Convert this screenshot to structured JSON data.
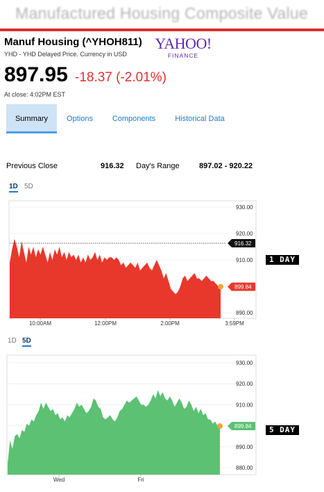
{
  "banner": {
    "title": "Manufactured Housing Composite Value"
  },
  "quote": {
    "name": "Manuf Housing (^YHOH811)",
    "subtitle": "YHD - YHD Delayed Price. Currency in USD",
    "price": "897.95",
    "change": "-18.37 (-2.01%)",
    "close_time": "At close: 4:02PM EST"
  },
  "logo": {
    "main": "YAHOO!",
    "sub": "FINANCE"
  },
  "tabs": [
    {
      "label": "Summary"
    },
    {
      "label": "Options"
    },
    {
      "label": "Components"
    },
    {
      "label": "Historical Data"
    }
  ],
  "stats": {
    "prev_close_label": "Previous Close",
    "prev_close_value": "916.32",
    "days_range_label": "Day's Range",
    "days_range_value": "897.02 - 920.22"
  },
  "range_tabs": {
    "one_day": "1D",
    "five_day": "5D"
  },
  "labels": {
    "one_day": "1 DAY",
    "five_day": "5 DAY"
  },
  "colors": {
    "down": "#e8382c",
    "up": "#5cc173",
    "accent": "#1f79d0",
    "marker": "#f2a33a"
  },
  "chart_data": [
    {
      "type": "area",
      "range": "1D",
      "color": "#e8382c",
      "ylim": [
        890,
        930
      ],
      "yticks": [
        "930.00",
        "920.00",
        "910.00",
        "900.00",
        "890.00"
      ],
      "xticks": [
        "10:00AM",
        "12:00PM",
        "2:00PM",
        "3:59PM"
      ],
      "reference_label": "916.32",
      "reference_value": 916.32,
      "last_label": "899.84",
      "last_value": 899.84,
      "values": [
        909,
        914,
        918,
        915,
        911,
        917,
        913,
        909,
        915,
        912,
        915,
        911,
        914,
        912,
        915,
        912,
        909,
        913,
        910,
        914,
        912,
        915,
        911,
        913,
        910,
        913,
        911,
        912,
        910,
        912,
        909,
        911,
        909,
        912,
        910,
        911,
        913,
        910,
        912,
        909,
        911,
        910,
        911,
        911,
        910,
        911,
        910,
        908,
        909,
        907,
        908,
        909,
        908,
        907,
        909,
        906,
        907,
        908,
        909,
        907,
        906,
        908,
        910,
        908,
        906,
        903,
        905,
        902,
        899,
        898,
        897,
        898,
        900,
        903,
        904,
        902,
        903,
        904,
        905,
        903,
        903,
        902,
        903,
        904,
        903,
        902,
        902,
        901,
        900,
        899.84
      ]
    },
    {
      "type": "area",
      "range": "5D",
      "color": "#5cc173",
      "ylim": [
        880,
        930
      ],
      "yticks": [
        "930.00",
        "920.00",
        "910.00",
        "900.00",
        "890.00",
        "880.00"
      ],
      "xticks": [
        "Wed",
        "Fri"
      ],
      "last_label": "899.84",
      "last_value": 899.84,
      "values": [
        882,
        893,
        889,
        895,
        896,
        894,
        898,
        897,
        901,
        900,
        903,
        902,
        905,
        907,
        911,
        908,
        911,
        909,
        907,
        908,
        905,
        906,
        903,
        904,
        902,
        905,
        904,
        906,
        908,
        911,
        909,
        910,
        908,
        906,
        907,
        909,
        913,
        912,
        909,
        908,
        904,
        903,
        904,
        905,
        903,
        902,
        904,
        907,
        908,
        910,
        912,
        911,
        912,
        913,
        914,
        912,
        910,
        910,
        909,
        910,
        912,
        915,
        913,
        917,
        914,
        916,
        913,
        912,
        914,
        912,
        909,
        911,
        913,
        911,
        908,
        909,
        912,
        910,
        907,
        909,
        906,
        908,
        905,
        906,
        903,
        903,
        901,
        902,
        900,
        899.84
      ]
    }
  ]
}
